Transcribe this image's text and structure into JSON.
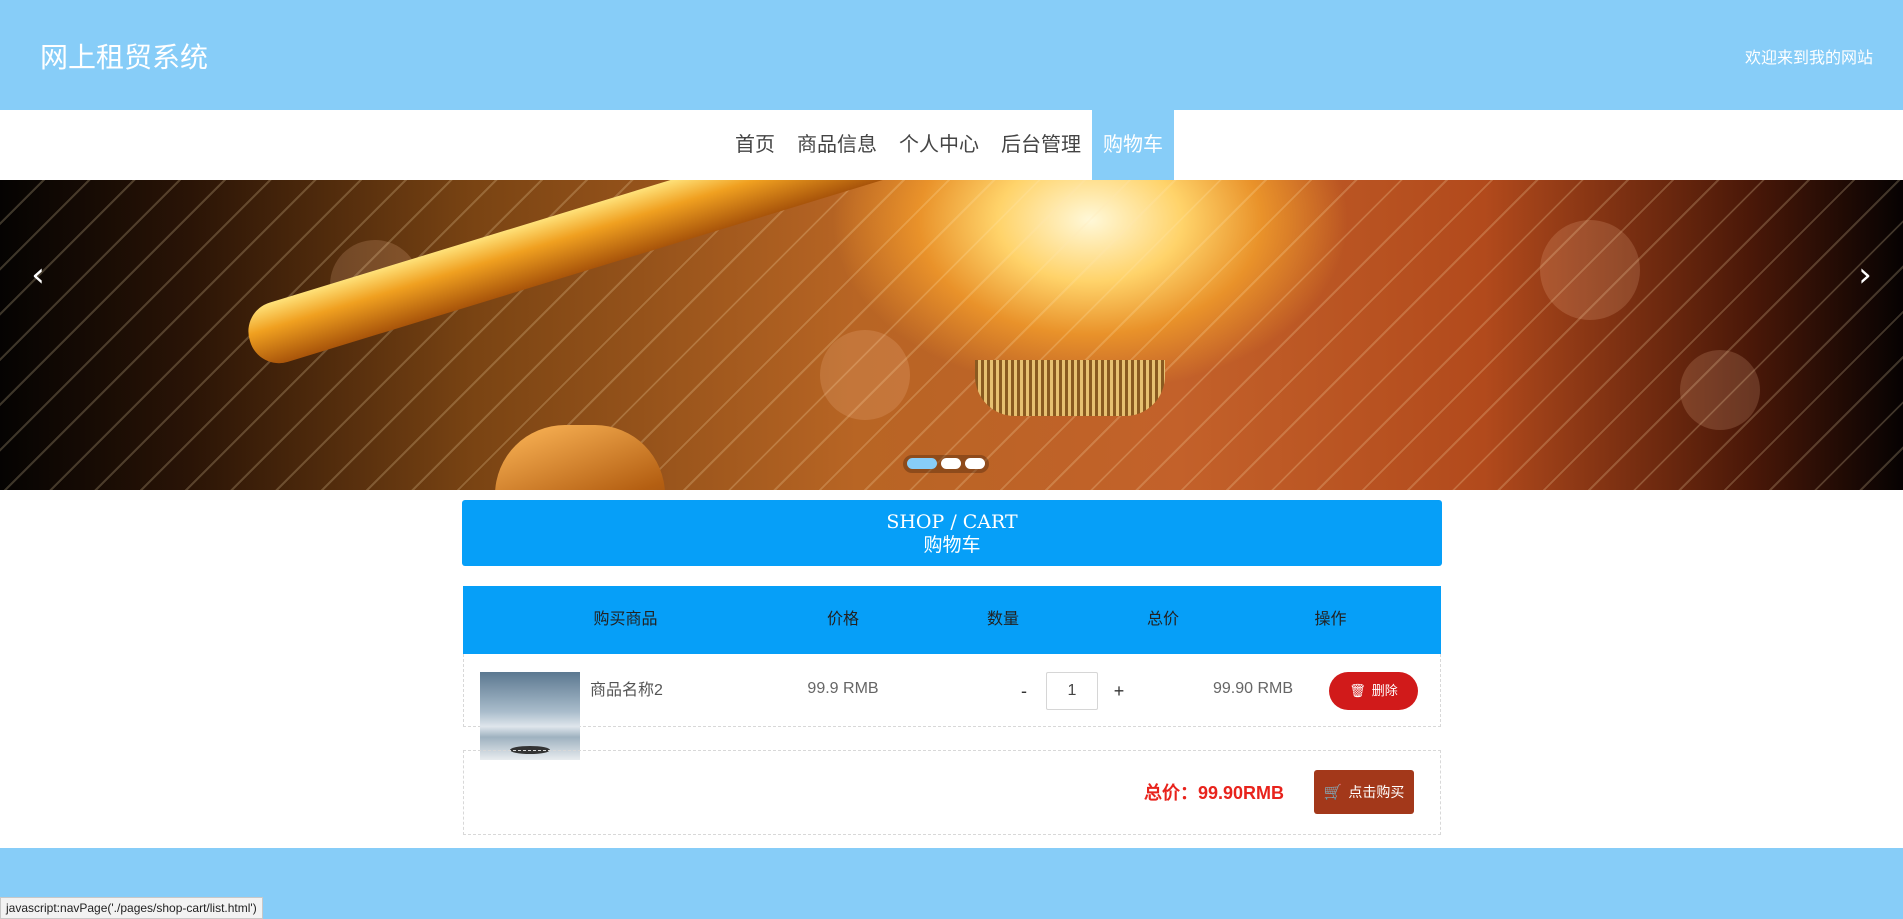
{
  "header": {
    "site_title": "网上租贸系统",
    "welcome": "欢迎来到我的网站"
  },
  "nav": {
    "items": [
      {
        "label": "首页"
      },
      {
        "label": "商品信息"
      },
      {
        "label": "个人中心"
      },
      {
        "label": "后台管理"
      },
      {
        "label": "购物车",
        "active": true
      }
    ]
  },
  "banner": {
    "prev_icon": "chevron-left-icon",
    "next_icon": "chevron-right-icon",
    "slide_count": 3,
    "active_slide": 1,
    "subject": "microphone"
  },
  "section": {
    "title_en": "SHOP / CART",
    "title_cn": "购物车"
  },
  "cart": {
    "columns": [
      "购买商品",
      "价格",
      "数量",
      "总价",
      "操作"
    ],
    "rows": [
      {
        "name": "商品名称2",
        "price": "99.9 RMB",
        "quantity": "1",
        "minus": "-",
        "plus": "+",
        "subtotal": "99.90 RMB",
        "delete_label": "删除",
        "delete_icon": "trash-icon"
      }
    ],
    "total_label": "总价：99.90RMB",
    "buy_label": "点击购买",
    "buy_icon": "cart-icon"
  },
  "status_bar": {
    "text": "javascript:navPage('./pages/shop-cart/list.html')"
  },
  "colors": {
    "header_bg": "#87cdf8",
    "accent_blue": "#069ff8",
    "delete_red": "#d11a1a",
    "buy_brown": "#a3381a",
    "total_red": "#e8231c"
  }
}
